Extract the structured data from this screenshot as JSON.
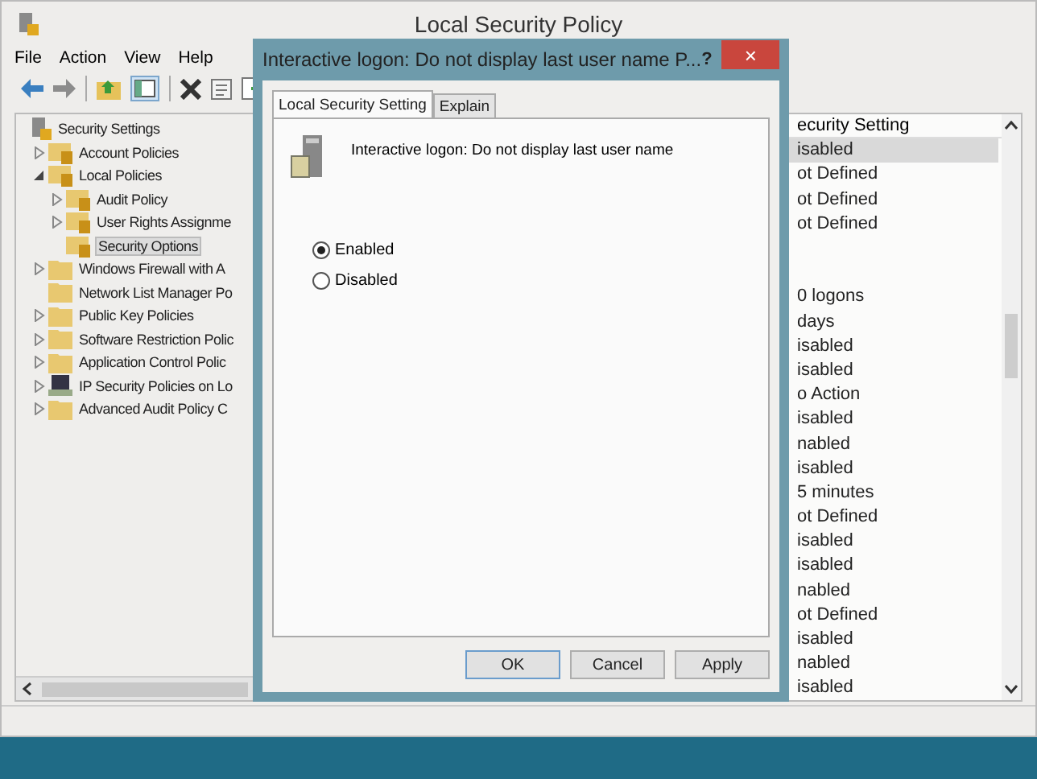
{
  "window": {
    "title": "Local Security Policy"
  },
  "menu": [
    "File",
    "Action",
    "View",
    "Help"
  ],
  "tree": [
    {
      "label": "Security Settings",
      "kind": "root",
      "selected": false,
      "children": [
        {
          "label": "Account Policies",
          "kind": "locked-folder",
          "expanded": false,
          "selected": false
        },
        {
          "label": "Local Policies",
          "kind": "locked-folder",
          "expanded": true,
          "selected": false,
          "children": [
            {
              "label": "Audit Policy",
              "kind": "locked-folder",
              "expanded": false,
              "selected": false
            },
            {
              "label": "User Rights Assignme",
              "kind": "locked-folder",
              "expanded": false,
              "selected": false
            },
            {
              "label": "Security Options",
              "kind": "locked-folder",
              "selected": true
            }
          ]
        },
        {
          "label": "Windows Firewall with A",
          "kind": "folder",
          "expanded": false,
          "selected": false
        },
        {
          "label": "Network List Manager Po",
          "kind": "folder",
          "selected": false
        },
        {
          "label": "Public Key Policies",
          "kind": "folder",
          "expanded": false,
          "selected": false
        },
        {
          "label": "Software Restriction Polic",
          "kind": "folder",
          "expanded": false,
          "selected": false
        },
        {
          "label": "Application Control Polic",
          "kind": "folder",
          "expanded": false,
          "selected": false
        },
        {
          "label": "IP Security Policies on Lo",
          "kind": "computer",
          "expanded": false,
          "selected": false
        },
        {
          "label": "Advanced Audit Policy C",
          "kind": "folder",
          "expanded": false,
          "selected": false
        }
      ]
    }
  ],
  "list": {
    "header": "ecurity Setting",
    "rows": [
      {
        "setting": "isabled",
        "selected": true
      },
      {
        "setting": "ot Defined",
        "selected": false
      },
      {
        "setting": "ot Defined",
        "selected": false
      },
      {
        "setting": "ot Defined",
        "selected": false
      },
      {
        "selected": false
      },
      {
        "selected": false
      },
      {
        "setting": "0 logons",
        "selected": false
      },
      {
        "setting": "days",
        "selected": false
      },
      {
        "setting": "isabled",
        "selected": false
      },
      {
        "setting": "isabled",
        "selected": false
      },
      {
        "setting": "o Action",
        "selected": false
      },
      {
        "setting": "isabled",
        "selected": false
      },
      {
        "setting": "nabled",
        "selected": false
      },
      {
        "setting": "isabled",
        "selected": false
      },
      {
        "setting": "5 minutes",
        "selected": false
      },
      {
        "setting": "ot Defined",
        "selected": false
      },
      {
        "setting": "isabled",
        "selected": false
      },
      {
        "setting": "isabled",
        "selected": false
      },
      {
        "setting": "nabled",
        "selected": false
      },
      {
        "setting": "ot Defined",
        "selected": false
      },
      {
        "setting": "isabled",
        "selected": false
      },
      {
        "setting": "nabled",
        "selected": false
      },
      {
        "setting": "isabled",
        "selected": false
      }
    ]
  },
  "dialog": {
    "title": "Interactive logon: Do not display last user name P...",
    "help": "?",
    "close": "×",
    "tabs": [
      {
        "label": "Local Security Setting",
        "selected": true
      },
      {
        "label": "Explain",
        "selected": false
      }
    ],
    "description": "Interactive logon: Do not display last user name",
    "options": [
      {
        "label": "Enabled",
        "checked": true
      },
      {
        "label": "Disabled",
        "checked": false
      }
    ],
    "buttons": [
      "OK",
      "Cancel",
      "Apply"
    ]
  }
}
